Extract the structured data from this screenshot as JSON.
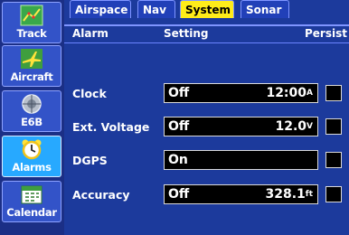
{
  "sidebar": {
    "items": [
      {
        "label": "Track",
        "icon": "track-icon"
      },
      {
        "label": "Aircraft",
        "icon": "airplane-icon"
      },
      {
        "label": "E6B",
        "icon": "flight-computer-icon"
      },
      {
        "label": "Alarms",
        "icon": "alarm-clock-icon",
        "active": true
      },
      {
        "label": "Calendar",
        "icon": "calendar-icon"
      }
    ]
  },
  "tabs": [
    {
      "label": "Airspace"
    },
    {
      "label": "Nav"
    },
    {
      "label": "System",
      "active": true
    },
    {
      "label": "Sonar"
    }
  ],
  "columns": {
    "alarm": "Alarm",
    "setting": "Setting",
    "persist": "Persist"
  },
  "rows": [
    {
      "label": "Clock",
      "state": "Off",
      "value": "12:00",
      "unit": "A",
      "persist": false
    },
    {
      "label": "Ext. Voltage",
      "state": "Off",
      "value": "12.0",
      "unit": "V",
      "persist": false
    },
    {
      "label": "DGPS",
      "state": "On",
      "value": "",
      "unit": "",
      "persist": false
    },
    {
      "label": "Accuracy",
      "state": "Off",
      "value": "328.1",
      "unit": "ft",
      "persist": false
    }
  ],
  "colors": {
    "background": "#1c3a9c",
    "active_tab": "#ffec1a",
    "active_sidebar": "#27a9ff"
  }
}
